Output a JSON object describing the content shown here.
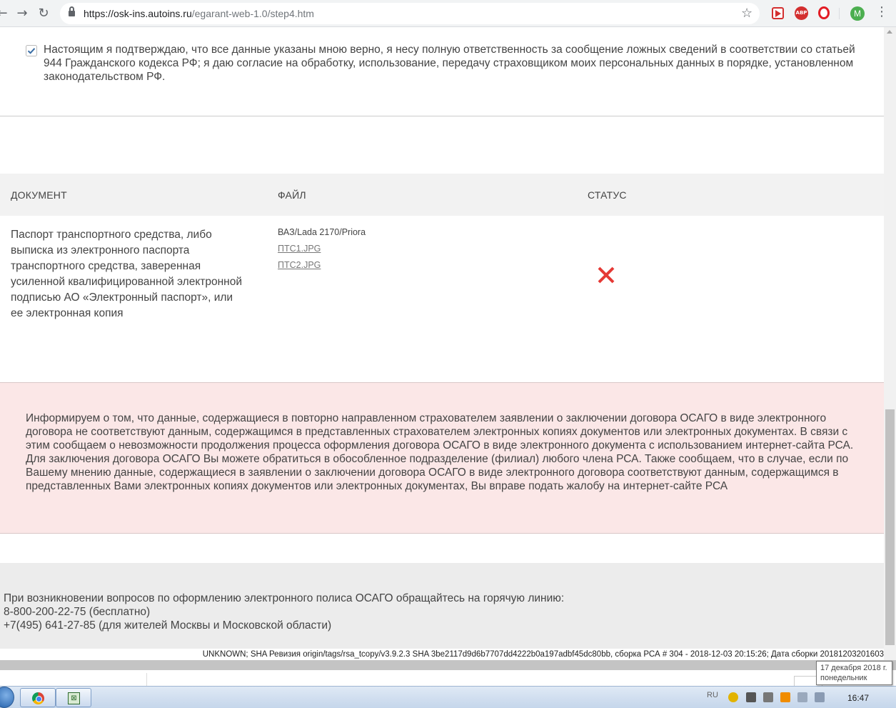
{
  "browser": {
    "url_host": "https://osk-ins.autoins.ru",
    "url_path": "/egarant-web-1.0/step4.htm",
    "back_icon": "back-arrow",
    "forward_icon": "forward-arrow",
    "reload_icon": "reload",
    "avatar_letter": "M",
    "abp_label": "ABP"
  },
  "consent": {
    "checked": true,
    "text": "Настоящим я подтверждаю, что все данные указаны мною верно, я несу полную ответственность за сообщение ложных сведений в соответствии со статьей 944 Гражданского кодекса РФ; я даю согласие на обработку, использование, передачу страховщиком моих персональных данных в порядке, установленном законодательством РФ."
  },
  "table": {
    "headers": [
      "ДОКУМЕНТ",
      "ФАЙЛ",
      "СТАТУС"
    ],
    "rows": [
      {
        "document": "Паспорт транспортного средства, либо выписка из электронного паспорта транспортного средства, заверенная усиленной квалифицированной электронной подписью АО «Электронный паспорт», или ее электронная копия",
        "file_title": "ВАЗ/Lada 2170/Priora",
        "files": [
          "ПТС1.JPG",
          "ПТС2.JPG"
        ],
        "status_icon": "red-x"
      }
    ]
  },
  "alert": {
    "text": "Информируем о том, что данные, содержащиеся в повторно направленном страхователем заявлении о заключении договора ОСАГО в виде электронного договора не соответствуют данным, содержащимся в представленных страхователем электронных копиях документов или электронных документах. В связи с этим сообщаем о невозможности продолжения процесса оформления договора ОСАГО в виде электронного документа с использованием интернет-сайта РСА. Для заключения договора ОСАГО Вы можете обратиться в обособленное подразделение (филиал) любого члена РСА. Также сообщаем, что в случае, если по Вашему мнению данные, содержащиеся в заявлении о заключении договора ОСАГО в виде электронного договора соответствуют данным, содержащимся в представленных Вами электронных копиях документов или электронных документах, Вы вправе подать жалобу на интернет-сайте РСА",
    "background": "#fbe7e7"
  },
  "footer": {
    "line1": "При возникновении вопросов по оформлению электронного полиса ОСАГО обращайтесь на горячую линию:",
    "line2": "8-800-200-22-75 (бесплатно)",
    "line3": "+7(495) 641-27-85 (для жителей Москвы и Московской области)",
    "build": "UNKNOWN; SHA Ревизия origin/tags/rsa_tcopy/v3.9.2.3 SHA 3be2117d9d6b7707dd4222b0a197adbf45dc80bb, сборка РСА # 304 - 2018-12-03 20:15:26; Дата сборки 20181203201603"
  },
  "taskbar": {
    "lang": "RU",
    "time": "16:47",
    "tooltip_date": "17 декабря 2018 г.",
    "tooltip_day": "понедельник"
  },
  "colors": {
    "status_error": "#e53935",
    "check_accent": "#3a6ea5"
  }
}
